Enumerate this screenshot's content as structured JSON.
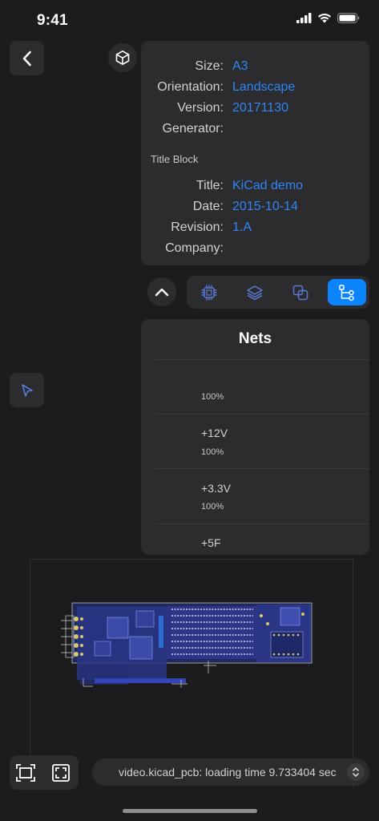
{
  "status_bar": {
    "time": "9:41"
  },
  "properties": [
    {
      "label": "Size:",
      "value": "A3"
    },
    {
      "label": "Orientation:",
      "value": "Landscape"
    },
    {
      "label": "Version:",
      "value": "20171130"
    },
    {
      "label": "Generator:",
      "value": ""
    }
  ],
  "title_block": {
    "heading": "Title Block",
    "fields": [
      {
        "label": "Title:",
        "value": "KiCad demo"
      },
      {
        "label": "Date:",
        "value": "2015-10-14"
      },
      {
        "label": "Revision:",
        "value": "1.A"
      },
      {
        "label": "Company:",
        "value": ""
      }
    ]
  },
  "segments": {
    "items": [
      "chip-icon",
      "layers-icon",
      "overlap-icon",
      "nets-icon"
    ],
    "selected": 3
  },
  "nets": {
    "title": "Nets",
    "items": [
      {
        "name": "",
        "percent": "100%"
      },
      {
        "name": "+12V",
        "percent": "100%"
      },
      {
        "name": "+3.3V",
        "percent": "100%"
      },
      {
        "name": "+5F",
        "percent": ""
      }
    ]
  },
  "status_field": {
    "text": "video.kicad_pcb: loading time 9.733404 sec"
  },
  "colors": {
    "accent": "#0a84ff",
    "link": "#2f86f6",
    "panel": "#2c2c2e",
    "background": "#1c1c1e"
  }
}
